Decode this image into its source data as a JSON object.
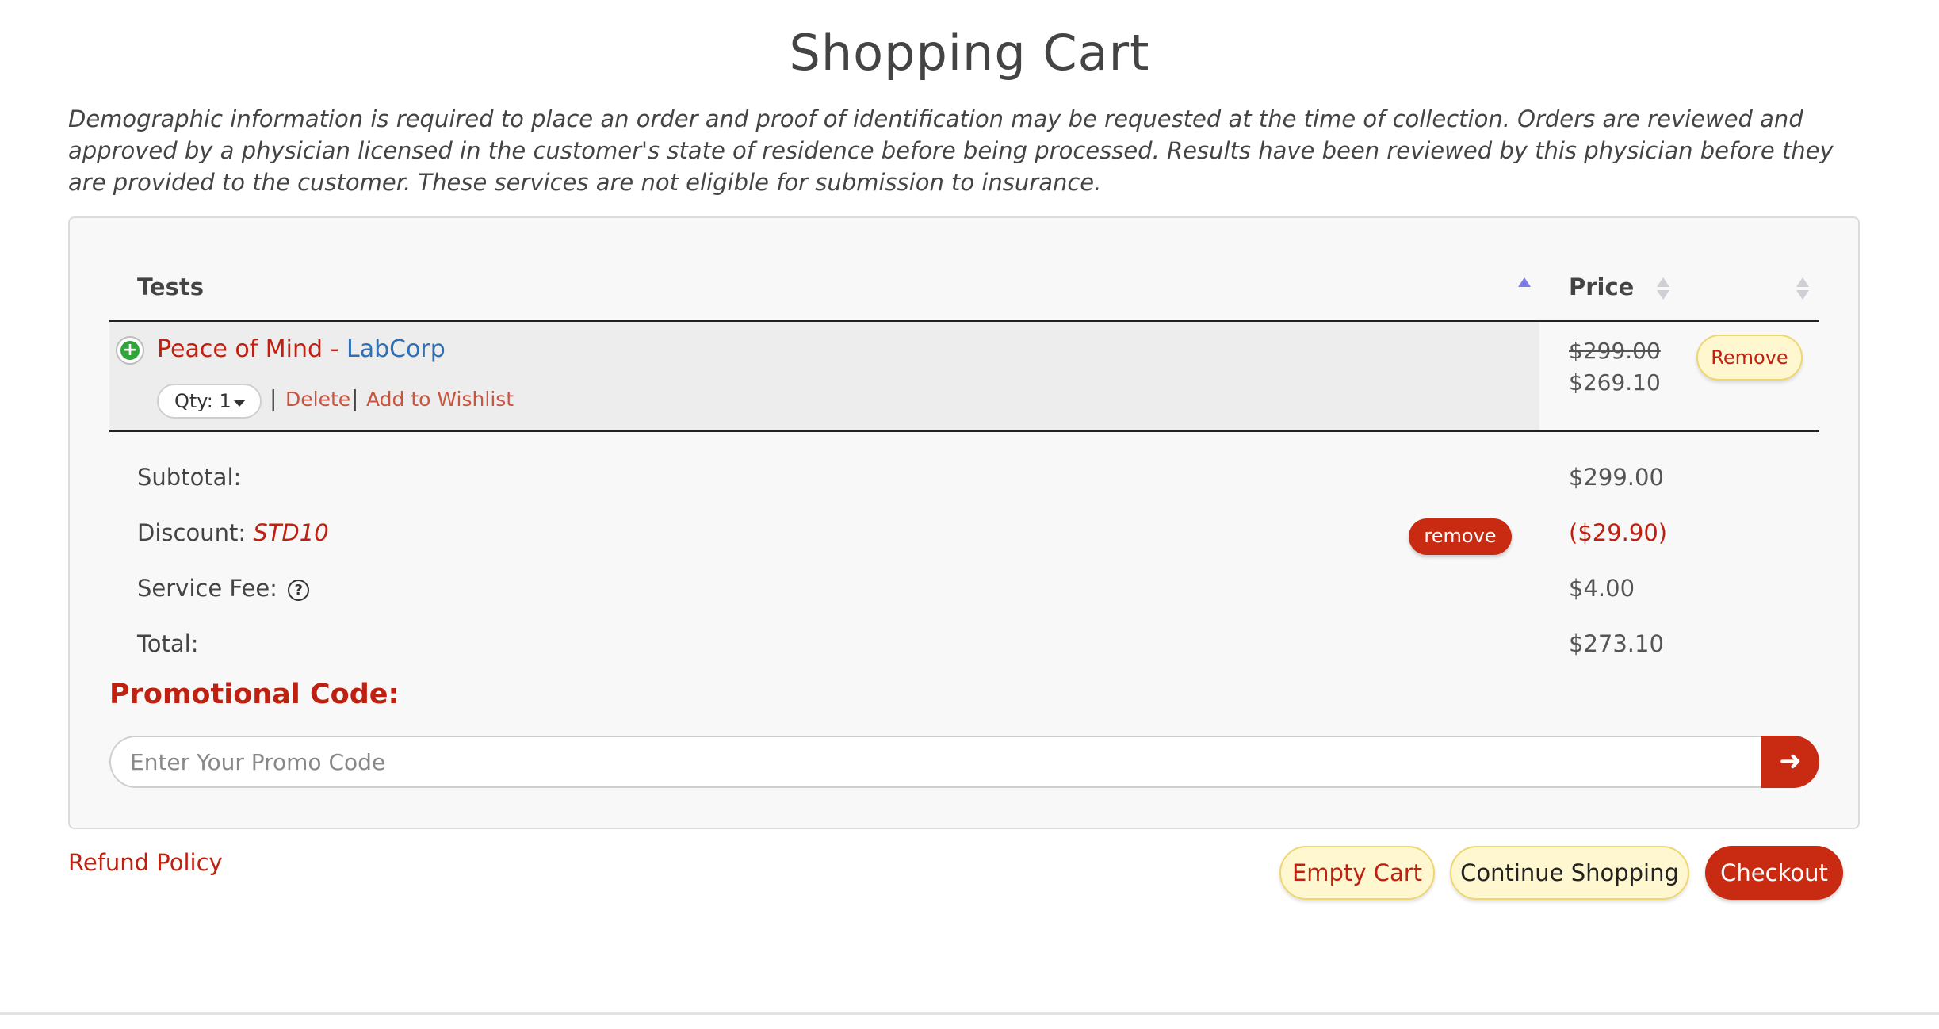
{
  "page": {
    "title": "Shopping Cart",
    "disclaimer": "Demographic information is required to place an order and proof of identification may be requested at the time of collection. Orders are reviewed and approved by a physician licensed in the customer's state of residence before being processed. Results have been reviewed by this physician before they are provided to the customer. These services are not eligible for submission to insurance."
  },
  "table": {
    "headers": {
      "tests": "Tests",
      "price": "Price"
    },
    "items": [
      {
        "name": "Peace of Mind",
        "separator": " - ",
        "lab": "LabCorp",
        "qty_label": "Qty: 1",
        "delete_label": "Delete",
        "wishlist_label": "Add to Wishlist",
        "original_price": "$299.00",
        "price": "$269.10",
        "remove_label": "Remove"
      }
    ]
  },
  "summary": {
    "subtotal_label": "Subtotal:",
    "subtotal_value": "$299.00",
    "discount_label": "Discount:",
    "discount_code": "STD10",
    "discount_remove_label": "remove",
    "discount_value": "($29.90)",
    "service_fee_label": "Service Fee:",
    "service_fee_value": "$4.00",
    "total_label": "Total:",
    "total_value": "$273.10"
  },
  "promo": {
    "label": "Promotional Code:",
    "placeholder": "Enter Your Promo Code",
    "value": ""
  },
  "footer": {
    "refund_label": "Refund Policy",
    "empty_cart_label": "Empty Cart",
    "continue_label": "Continue Shopping",
    "checkout_label": "Checkout"
  },
  "icons": {
    "expand": "plus-circle-icon",
    "help": "question-circle-icon",
    "submit": "arrow-right-icon",
    "qty_caret": "caret-down-icon"
  },
  "colors": {
    "accent_red": "#c82b12",
    "link_blue": "#2f6fb5",
    "button_yellow": "#fff7cf",
    "success_green": "#2ea43a"
  }
}
